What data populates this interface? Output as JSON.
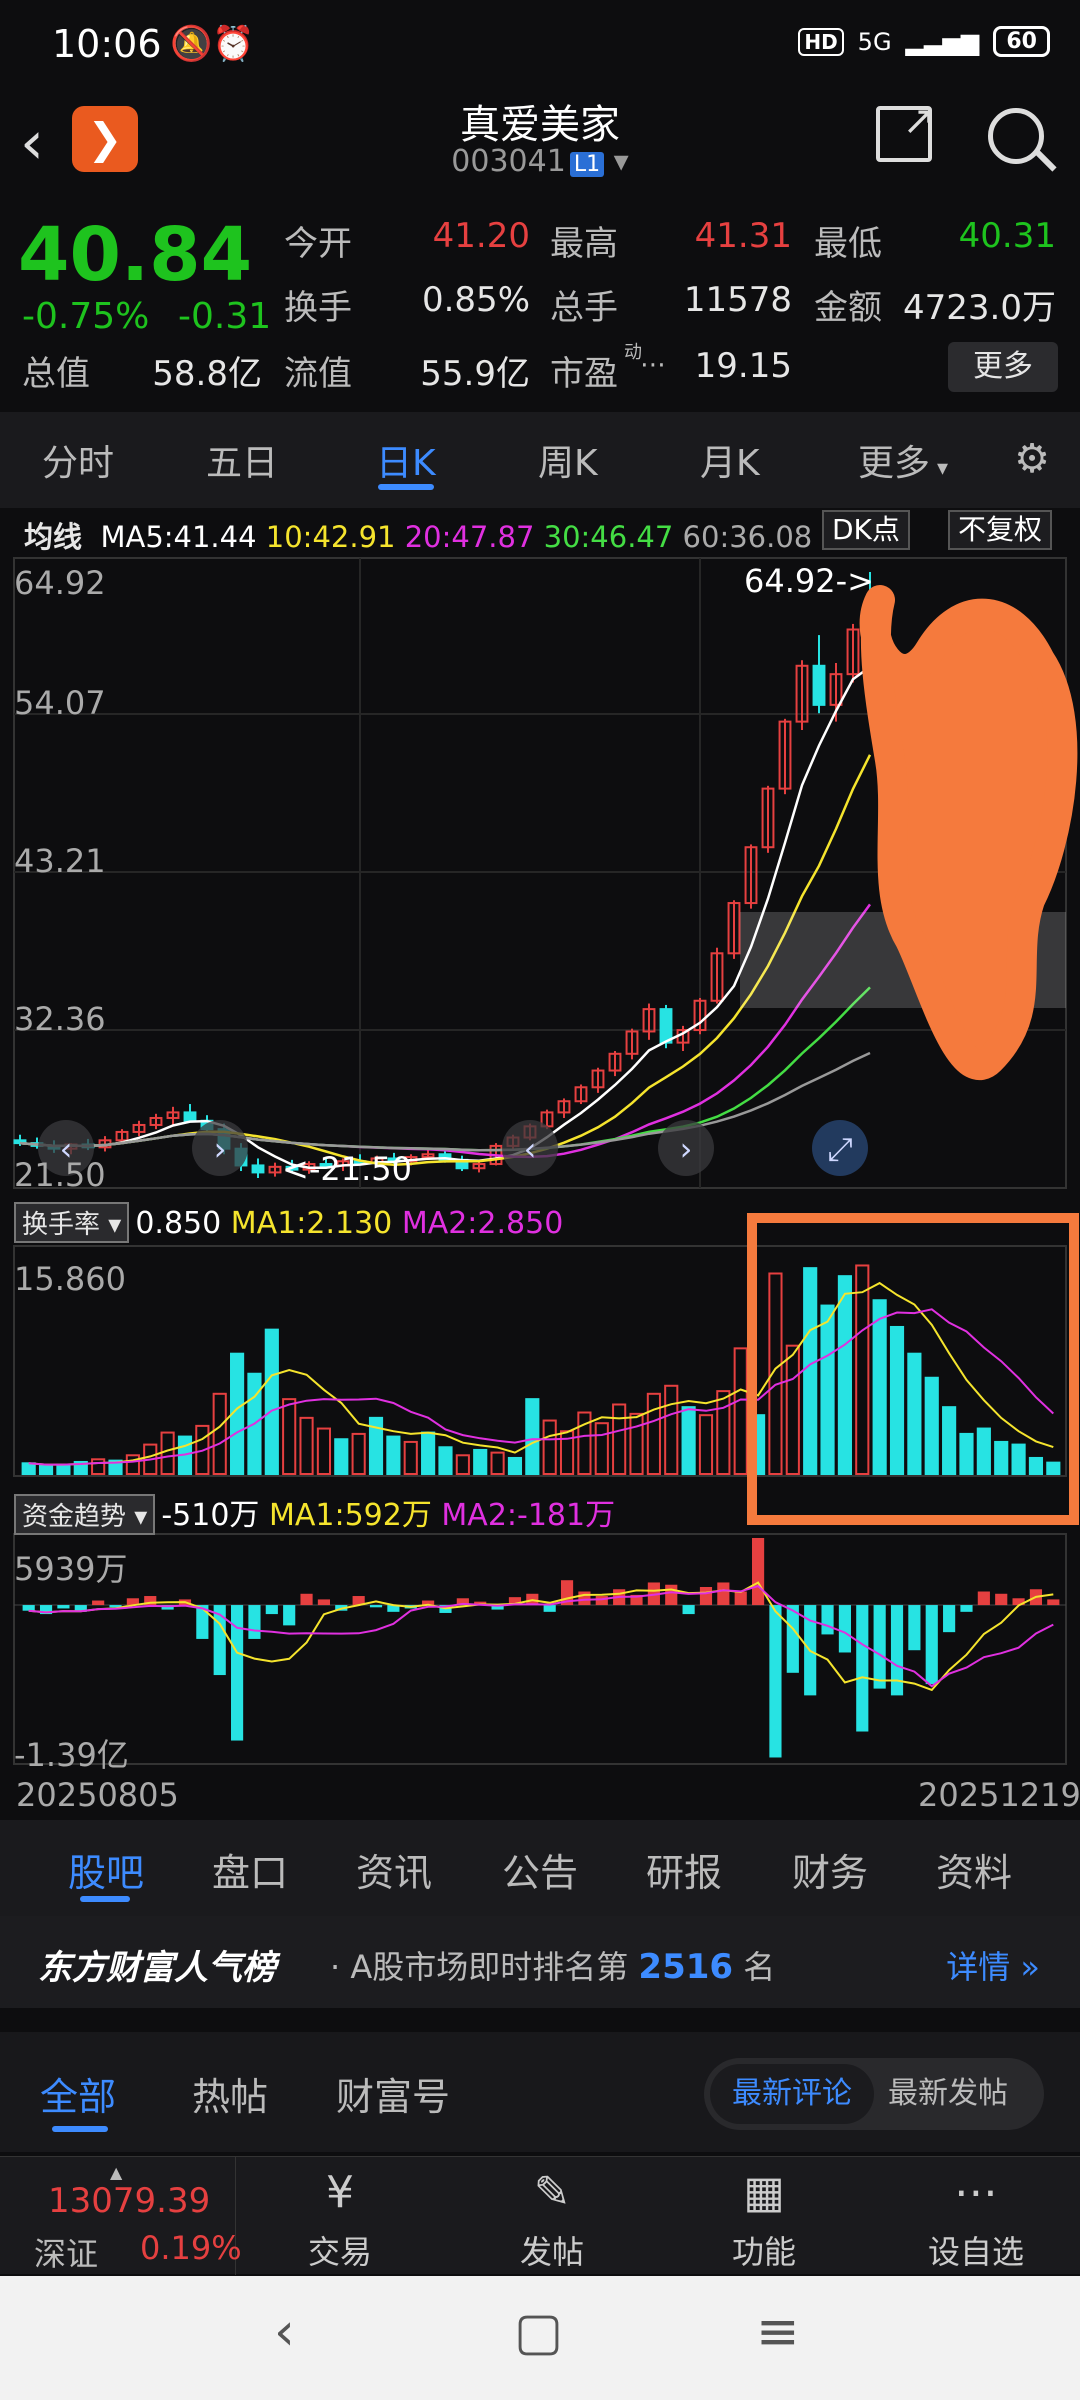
{
  "status": {
    "time": "10:06",
    "network": "5G",
    "battery": "60",
    "hd": "HD"
  },
  "header": {
    "name": "真爱美家",
    "code": "003041",
    "level": "L1"
  },
  "quote": {
    "price": "40.84",
    "pct": "-0.75%",
    "chg": "-0.31",
    "open_label": "今开",
    "open": "41.20",
    "high_label": "最高",
    "high": "41.31",
    "low_label": "最低",
    "low": "40.31",
    "turnover_label": "换手",
    "turnover": "0.85%",
    "volume_label": "总手",
    "volume": "11578",
    "amount_label": "金额",
    "amount": "4723.0万",
    "mktcap_label": "总值",
    "mktcap": "58.8亿",
    "float_label": "流值",
    "float": "55.9亿",
    "pe_label": "市盈",
    "pe_sup": "动",
    "pe": "19.15",
    "more": "更多"
  },
  "tabs": [
    "分时",
    "五日",
    "日K",
    "周K",
    "月K",
    "更多"
  ],
  "ma_legend": {
    "label": "均线",
    "ma5": "MA5:41.44",
    "ma10": "10:42.91",
    "ma20": "20:47.87",
    "ma30": "30:46.47",
    "ma60": "60:36.08",
    "dk": "DK点",
    "fq": "不复权"
  },
  "chart_data": [
    {
      "type": "candlestick",
      "y_ticks": [
        "64.92",
        "54.07",
        "43.21",
        "32.36",
        "21.50"
      ],
      "ylim": [
        21.5,
        64.92
      ],
      "annotations": [
        "64.92->",
        "<-21.50"
      ],
      "candles": [
        [
          24.2,
          24.6,
          23.8,
          24.0
        ],
        [
          24.0,
          24.4,
          23.6,
          23.8
        ],
        [
          23.8,
          24.2,
          23.3,
          23.6
        ],
        [
          23.6,
          24.0,
          23.2,
          23.9
        ],
        [
          23.9,
          24.3,
          23.5,
          23.7
        ],
        [
          23.7,
          24.5,
          23.4,
          24.2
        ],
        [
          24.2,
          25.0,
          24.0,
          24.8
        ],
        [
          24.8,
          25.6,
          24.5,
          25.3
        ],
        [
          25.3,
          26.1,
          25.0,
          25.8
        ],
        [
          25.8,
          26.6,
          25.2,
          26.2
        ],
        [
          26.2,
          26.8,
          25.5,
          25.6
        ],
        [
          25.6,
          26.0,
          24.8,
          25.0
        ],
        [
          25.0,
          25.4,
          23.2,
          23.6
        ],
        [
          23.6,
          24.0,
          22.0,
          22.4
        ],
        [
          22.4,
          22.9,
          21.5,
          21.9
        ],
        [
          21.9,
          22.6,
          21.6,
          22.3
        ],
        [
          22.3,
          22.8,
          21.9,
          22.1
        ],
        [
          22.1,
          22.7,
          21.8,
          22.5
        ],
        [
          22.5,
          23.0,
          22.2,
          22.4
        ],
        [
          22.4,
          22.9,
          22.0,
          22.7
        ],
        [
          22.7,
          23.2,
          22.4,
          22.6
        ],
        [
          22.6,
          23.1,
          22.3,
          22.9
        ],
        [
          22.9,
          23.3,
          22.5,
          22.7
        ],
        [
          22.7,
          23.2,
          22.4,
          23.0
        ],
        [
          23.0,
          23.5,
          22.8,
          23.2
        ],
        [
          23.2,
          23.6,
          22.6,
          22.8
        ],
        [
          22.8,
          23.1,
          22.0,
          22.2
        ],
        [
          22.2,
          22.7,
          21.9,
          22.5
        ],
        [
          22.5,
          24.0,
          22.4,
          23.8
        ],
        [
          23.8,
          24.6,
          23.5,
          24.4
        ],
        [
          24.4,
          25.4,
          24.2,
          25.2
        ],
        [
          25.2,
          26.4,
          25.0,
          26.2
        ],
        [
          26.2,
          27.2,
          25.8,
          27.0
        ],
        [
          27.0,
          28.2,
          26.8,
          28.0
        ],
        [
          28.0,
          29.4,
          27.6,
          29.2
        ],
        [
          29.2,
          30.6,
          28.8,
          30.4
        ],
        [
          30.4,
          32.2,
          30.0,
          32.0
        ],
        [
          32.0,
          34.0,
          31.4,
          33.6
        ],
        [
          33.6,
          33.9,
          30.8,
          31.2
        ],
        [
          31.2,
          32.4,
          30.6,
          32.1
        ],
        [
          32.1,
          34.4,
          31.8,
          34.2
        ],
        [
          34.2,
          38.0,
          34.0,
          37.6
        ],
        [
          37.6,
          41.4,
          37.2,
          41.2
        ],
        [
          41.2,
          45.4,
          40.8,
          45.2
        ],
        [
          45.2,
          49.6,
          44.8,
          49.4
        ],
        [
          49.4,
          54.4,
          49.0,
          54.2
        ],
        [
          54.2,
          58.6,
          53.6,
          58.2
        ],
        [
          58.2,
          60.4,
          54.8,
          55.4
        ],
        [
          55.4,
          58.4,
          54.2,
          57.6
        ],
        [
          57.6,
          61.2,
          57.0,
          60.8
        ],
        [
          60.8,
          64.92,
          57.8,
          58.6
        ]
      ]
    },
    {
      "type": "bar",
      "name": "换手率",
      "y_ticks": [
        "15.860"
      ],
      "ylim": [
        0,
        15.86
      ],
      "values": [
        0.8,
        0.6,
        0.7,
        0.9,
        1.1,
        1.0,
        1.4,
        2.2,
        3.1,
        2.8,
        3.6,
        6.0,
        9.0,
        7.5,
        10.8,
        5.6,
        4.2,
        3.4,
        2.6,
        3.0,
        4.2,
        2.8,
        2.4,
        3.1,
        2.0,
        1.4,
        1.8,
        1.6,
        1.2,
        5.6,
        4.0,
        3.2,
        4.6,
        3.8,
        5.2,
        4.5,
        6.0,
        6.6,
        5.0,
        4.4,
        6.2,
        9.4,
        4.4,
        15.0,
        9.6,
        15.4,
        12.6,
        14.8,
        15.6,
        13.0,
        11.0,
        9.0,
        7.2,
        5.0,
        3.0,
        3.4,
        2.4,
        2.2,
        1.2,
        0.85
      ],
      "red_up": [
        false,
        false,
        false,
        false,
        true,
        false,
        true,
        true,
        true,
        false,
        true,
        true,
        false,
        false,
        false,
        true,
        true,
        true,
        false,
        true,
        false,
        false,
        true,
        false,
        false,
        true,
        false,
        true,
        false,
        false,
        true,
        true,
        true,
        true,
        true,
        true,
        true,
        true,
        false,
        true,
        true,
        true,
        false,
        true,
        true,
        false,
        false,
        false,
        true,
        false,
        false,
        false,
        false,
        false,
        false,
        false,
        false,
        false,
        false,
        false
      ],
      "ma1": "MA1:2.130",
      "ma2": "MA2:2.850",
      "current": "0.850"
    },
    {
      "type": "bar",
      "name": "资金趋势",
      "y_ticks": [
        "5939万",
        "-1.39亿"
      ],
      "ylim": [
        -1.39,
        0.5939
      ],
      "values": [
        -0.05,
        -0.08,
        -0.03,
        -0.06,
        0.04,
        -0.02,
        0.06,
        0.08,
        -0.04,
        0.05,
        -0.3,
        -0.62,
        -1.2,
        -0.3,
        -0.08,
        -0.18,
        0.1,
        0.05,
        -0.05,
        0.08,
        -0.02,
        -0.06,
        -0.03,
        0.04,
        -0.07,
        0.06,
        0.03,
        -0.04,
        0.07,
        0.1,
        -0.06,
        0.22,
        0.12,
        0.08,
        0.14,
        0.09,
        0.2,
        0.18,
        -0.08,
        0.16,
        0.2,
        0.12,
        0.594,
        -1.35,
        -0.6,
        -0.8,
        -0.26,
        -0.42,
        -1.12,
        -0.74,
        -0.8,
        -0.4,
        -0.7,
        -0.24,
        -0.06,
        0.12,
        0.1,
        0.06,
        0.14,
        0.05
      ],
      "x_labels": [
        "20250805",
        "20251219"
      ],
      "ma1": "MA1:592万",
      "ma2": "MA2:-181万",
      "current": "-510万"
    }
  ],
  "lower_tabs": [
    "股吧",
    "盘口",
    "资讯",
    "公告",
    "研报",
    "财务",
    "资料"
  ],
  "rank": {
    "brand": "东方财富人气榜",
    "text": "· A股市场即时排名第",
    "num": "2516",
    "unit": "名",
    "detail": "详情"
  },
  "feed_tabs": [
    "全部",
    "热帖",
    "财富号"
  ],
  "sort": {
    "latest_comment": "最新评论",
    "latest_post": "最新发帖"
  },
  "bottom": {
    "index_value": "13079.39",
    "index_name": "深证",
    "index_pct": "0.19%",
    "items": [
      "交易",
      "发帖",
      "功能",
      "设自选"
    ]
  },
  "colors": {
    "up": "#e64040",
    "down": "#1ec31e",
    "accent": "#3d8bff",
    "candle_down": "#27e3e3",
    "annotation": "#f57a3d"
  }
}
